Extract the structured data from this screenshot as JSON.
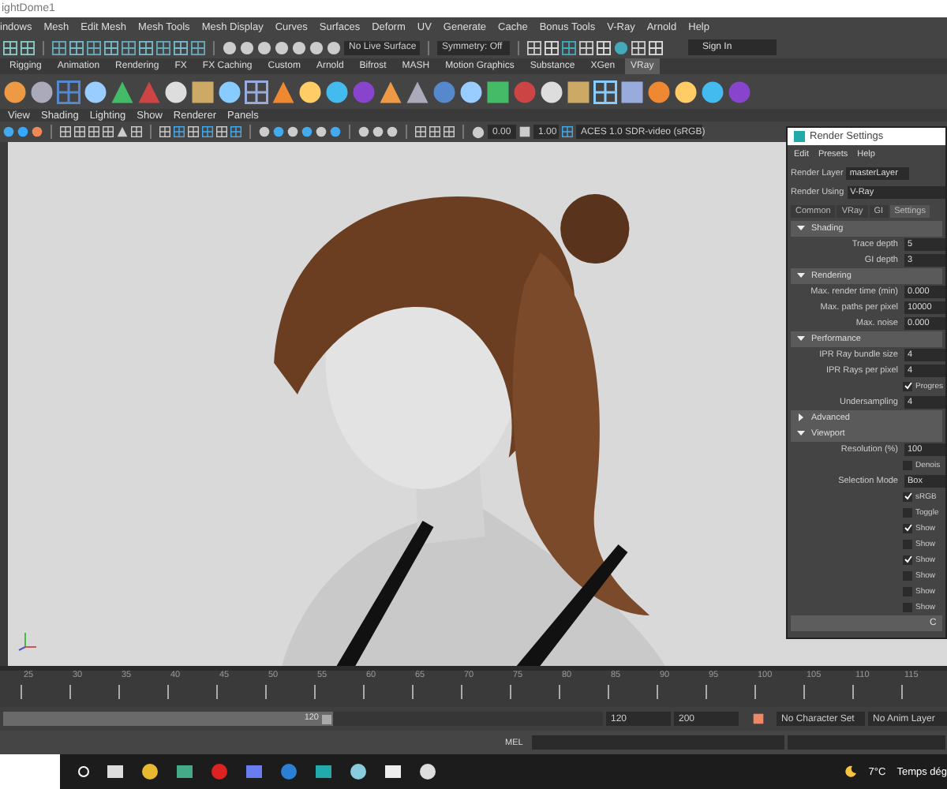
{
  "window": {
    "title": "ightDome1"
  },
  "menu_bar": [
    "indows",
    "Mesh",
    "Edit Mesh",
    "Mesh Tools",
    "Mesh Display",
    "Curves",
    "Surfaces",
    "Deform",
    "UV",
    "Generate",
    "Cache",
    "Bonus Tools",
    "V-Ray",
    "Arnold",
    "Help"
  ],
  "status_line": {
    "live_surface": "No Live Surface",
    "symmetry": "Symmetry: Off",
    "sign_in": "Sign In"
  },
  "shelf_tabs": [
    {
      "label": "Rigging",
      "selected": false
    },
    {
      "label": "Animation",
      "selected": false
    },
    {
      "label": "Rendering",
      "selected": false
    },
    {
      "label": "FX",
      "selected": false
    },
    {
      "label": "FX Caching",
      "selected": false
    },
    {
      "label": "Custom",
      "selected": false
    },
    {
      "label": "Arnold",
      "selected": false
    },
    {
      "label": "Bifrost",
      "selected": false
    },
    {
      "label": "MASH",
      "selected": false
    },
    {
      "label": "Motion Graphics",
      "selected": false
    },
    {
      "label": "Substance",
      "selected": false
    },
    {
      "label": "XGen",
      "selected": false
    },
    {
      "label": "VRay",
      "selected": true
    }
  ],
  "panel_menu": [
    "View",
    "Shading",
    "Lighting",
    "Show",
    "Renderer",
    "Panels"
  ],
  "panel_toolbar": {
    "exposure": "0.00",
    "gamma": "1.00",
    "color_space": "ACES 1.0 SDR-video (sRGB)"
  },
  "render_settings": {
    "title": "Render Settings",
    "menu": [
      "Edit",
      "Presets",
      "Help"
    ],
    "render_layer": {
      "label": "Render Layer",
      "value": "masterLayer"
    },
    "render_using": {
      "label": "Render Using",
      "value": "V-Ray"
    },
    "tabs": [
      {
        "label": "Common",
        "selected": false
      },
      {
        "label": "VRay",
        "selected": false
      },
      {
        "label": "GI",
        "selected": false
      },
      {
        "label": "Settings",
        "selected": true
      }
    ],
    "sections": [
      {
        "title": "Shading",
        "expanded": true,
        "rows": [
          {
            "kind": "field",
            "label": "Trace depth",
            "value": "5"
          },
          {
            "kind": "field",
            "label": "GI depth",
            "value": "3"
          }
        ]
      },
      {
        "title": "Rendering",
        "expanded": true,
        "rows": [
          {
            "kind": "field",
            "label": "Max. render time (min)",
            "value": "0.000"
          },
          {
            "kind": "field",
            "label": "Max. paths per pixel",
            "value": "10000"
          },
          {
            "kind": "field",
            "label": "Max. noise",
            "value": "0.000"
          }
        ]
      },
      {
        "title": "Performance",
        "expanded": true,
        "rows": [
          {
            "kind": "field",
            "label": "IPR Ray bundle size",
            "value": "4"
          },
          {
            "kind": "field",
            "label": "IPR Rays per pixel",
            "value": "4"
          },
          {
            "kind": "checkbox",
            "label": "Progres",
            "checked": true
          },
          {
            "kind": "field",
            "label": "Undersampling",
            "value": "4"
          }
        ]
      },
      {
        "title": "Advanced",
        "expanded": false
      },
      {
        "title": "Viewport",
        "expanded": true,
        "rows": [
          {
            "kind": "field",
            "label": "Resolution (%)",
            "value": "100"
          },
          {
            "kind": "checkbox",
            "label": "Denois",
            "checked": false
          },
          {
            "kind": "field",
            "label": "Selection Mode",
            "value": "Box"
          },
          {
            "kind": "checkbox",
            "label": "sRGB",
            "checked": true
          },
          {
            "kind": "checkbox",
            "label": "Toggle",
            "checked": false
          },
          {
            "kind": "checkbox",
            "label": "Show",
            "checked": true
          },
          {
            "kind": "checkbox",
            "label": "Show",
            "checked": false
          },
          {
            "kind": "checkbox",
            "label": "Show",
            "checked": true
          },
          {
            "kind": "checkbox",
            "label": "Show",
            "checked": false
          },
          {
            "kind": "checkbox",
            "label": "Show",
            "checked": false
          },
          {
            "kind": "checkbox",
            "label": "Show",
            "checked": false
          }
        ]
      }
    ],
    "button": "C"
  },
  "time_slider": {
    "ticks": [
      "25",
      "30",
      "35",
      "40",
      "45",
      "50",
      "55",
      "60",
      "65",
      "70",
      "75",
      "80",
      "85",
      "90",
      "95",
      "100",
      "105",
      "110",
      "115"
    ]
  },
  "range_slider": {
    "level": 0.55,
    "current": "120",
    "start": "120",
    "end": "200",
    "character_set": "No Character Set",
    "anim_layer": "No Anim Layer"
  },
  "command_line": {
    "label": "MEL"
  },
  "taskbar": {
    "temperature": "7°C",
    "weather": "Temps dég"
  }
}
